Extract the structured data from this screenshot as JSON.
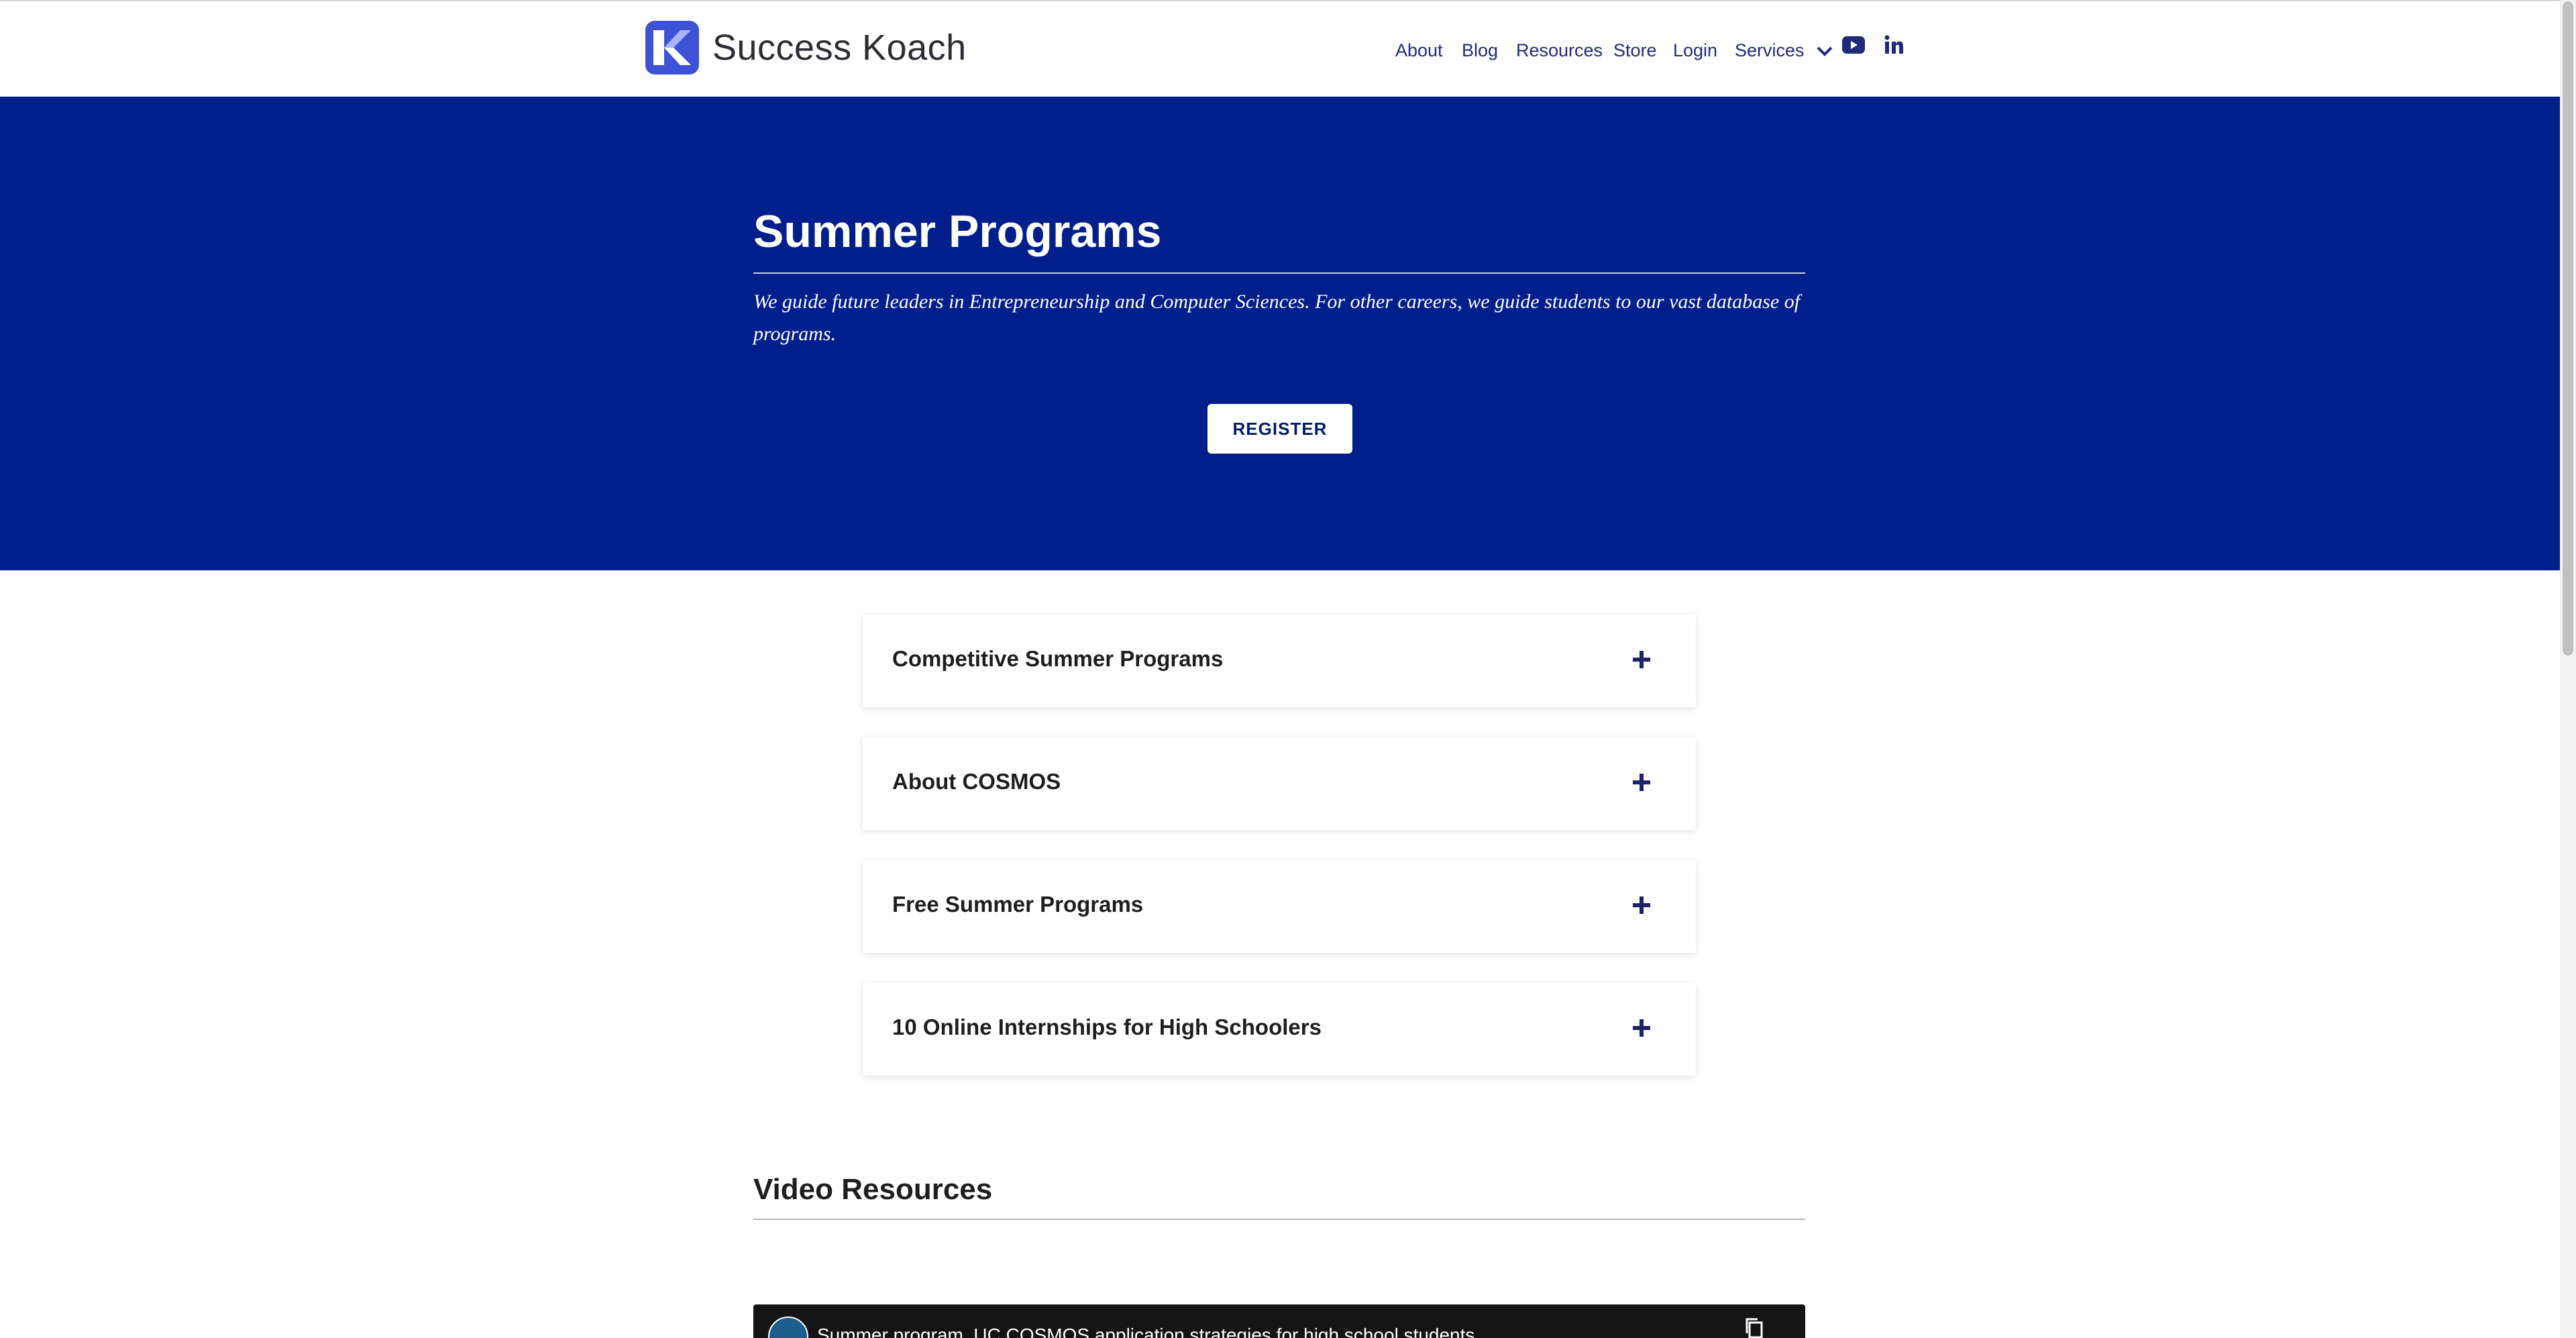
{
  "brand": {
    "name": "Success Koach",
    "logo_icon": "k-logo-icon",
    "accent": "#3d52d5"
  },
  "nav": {
    "about": "About",
    "blog": "Blog",
    "resources": "Resources",
    "store": "Store",
    "login": "Login",
    "services": "Services",
    "services_icon": "chevron-down-icon",
    "youtube_icon": "youtube-icon",
    "linkedin_icon": "linkedin-icon"
  },
  "hero": {
    "title": "Summer Programs",
    "subtitle": "We guide future leaders in Entrepreneurship and Computer Sciences. For other careers, we guide students to our vast database of programs.",
    "button": "REGISTER",
    "background": "#001f8a"
  },
  "accordion": [
    {
      "label": "Competitive Summer Programs",
      "icon": "plus-icon"
    },
    {
      "label": "About COSMOS",
      "icon": "plus-icon"
    },
    {
      "label": "Free Summer Programs",
      "icon": "plus-icon"
    },
    {
      "label": "10 Online Internships for High Schoolers",
      "icon": "plus-icon"
    }
  ],
  "video_section": {
    "title": "Video Resources",
    "video_title": "Summer program, UC COSMOS application strategies for high school students",
    "copy_icon": "copy-link-icon"
  }
}
